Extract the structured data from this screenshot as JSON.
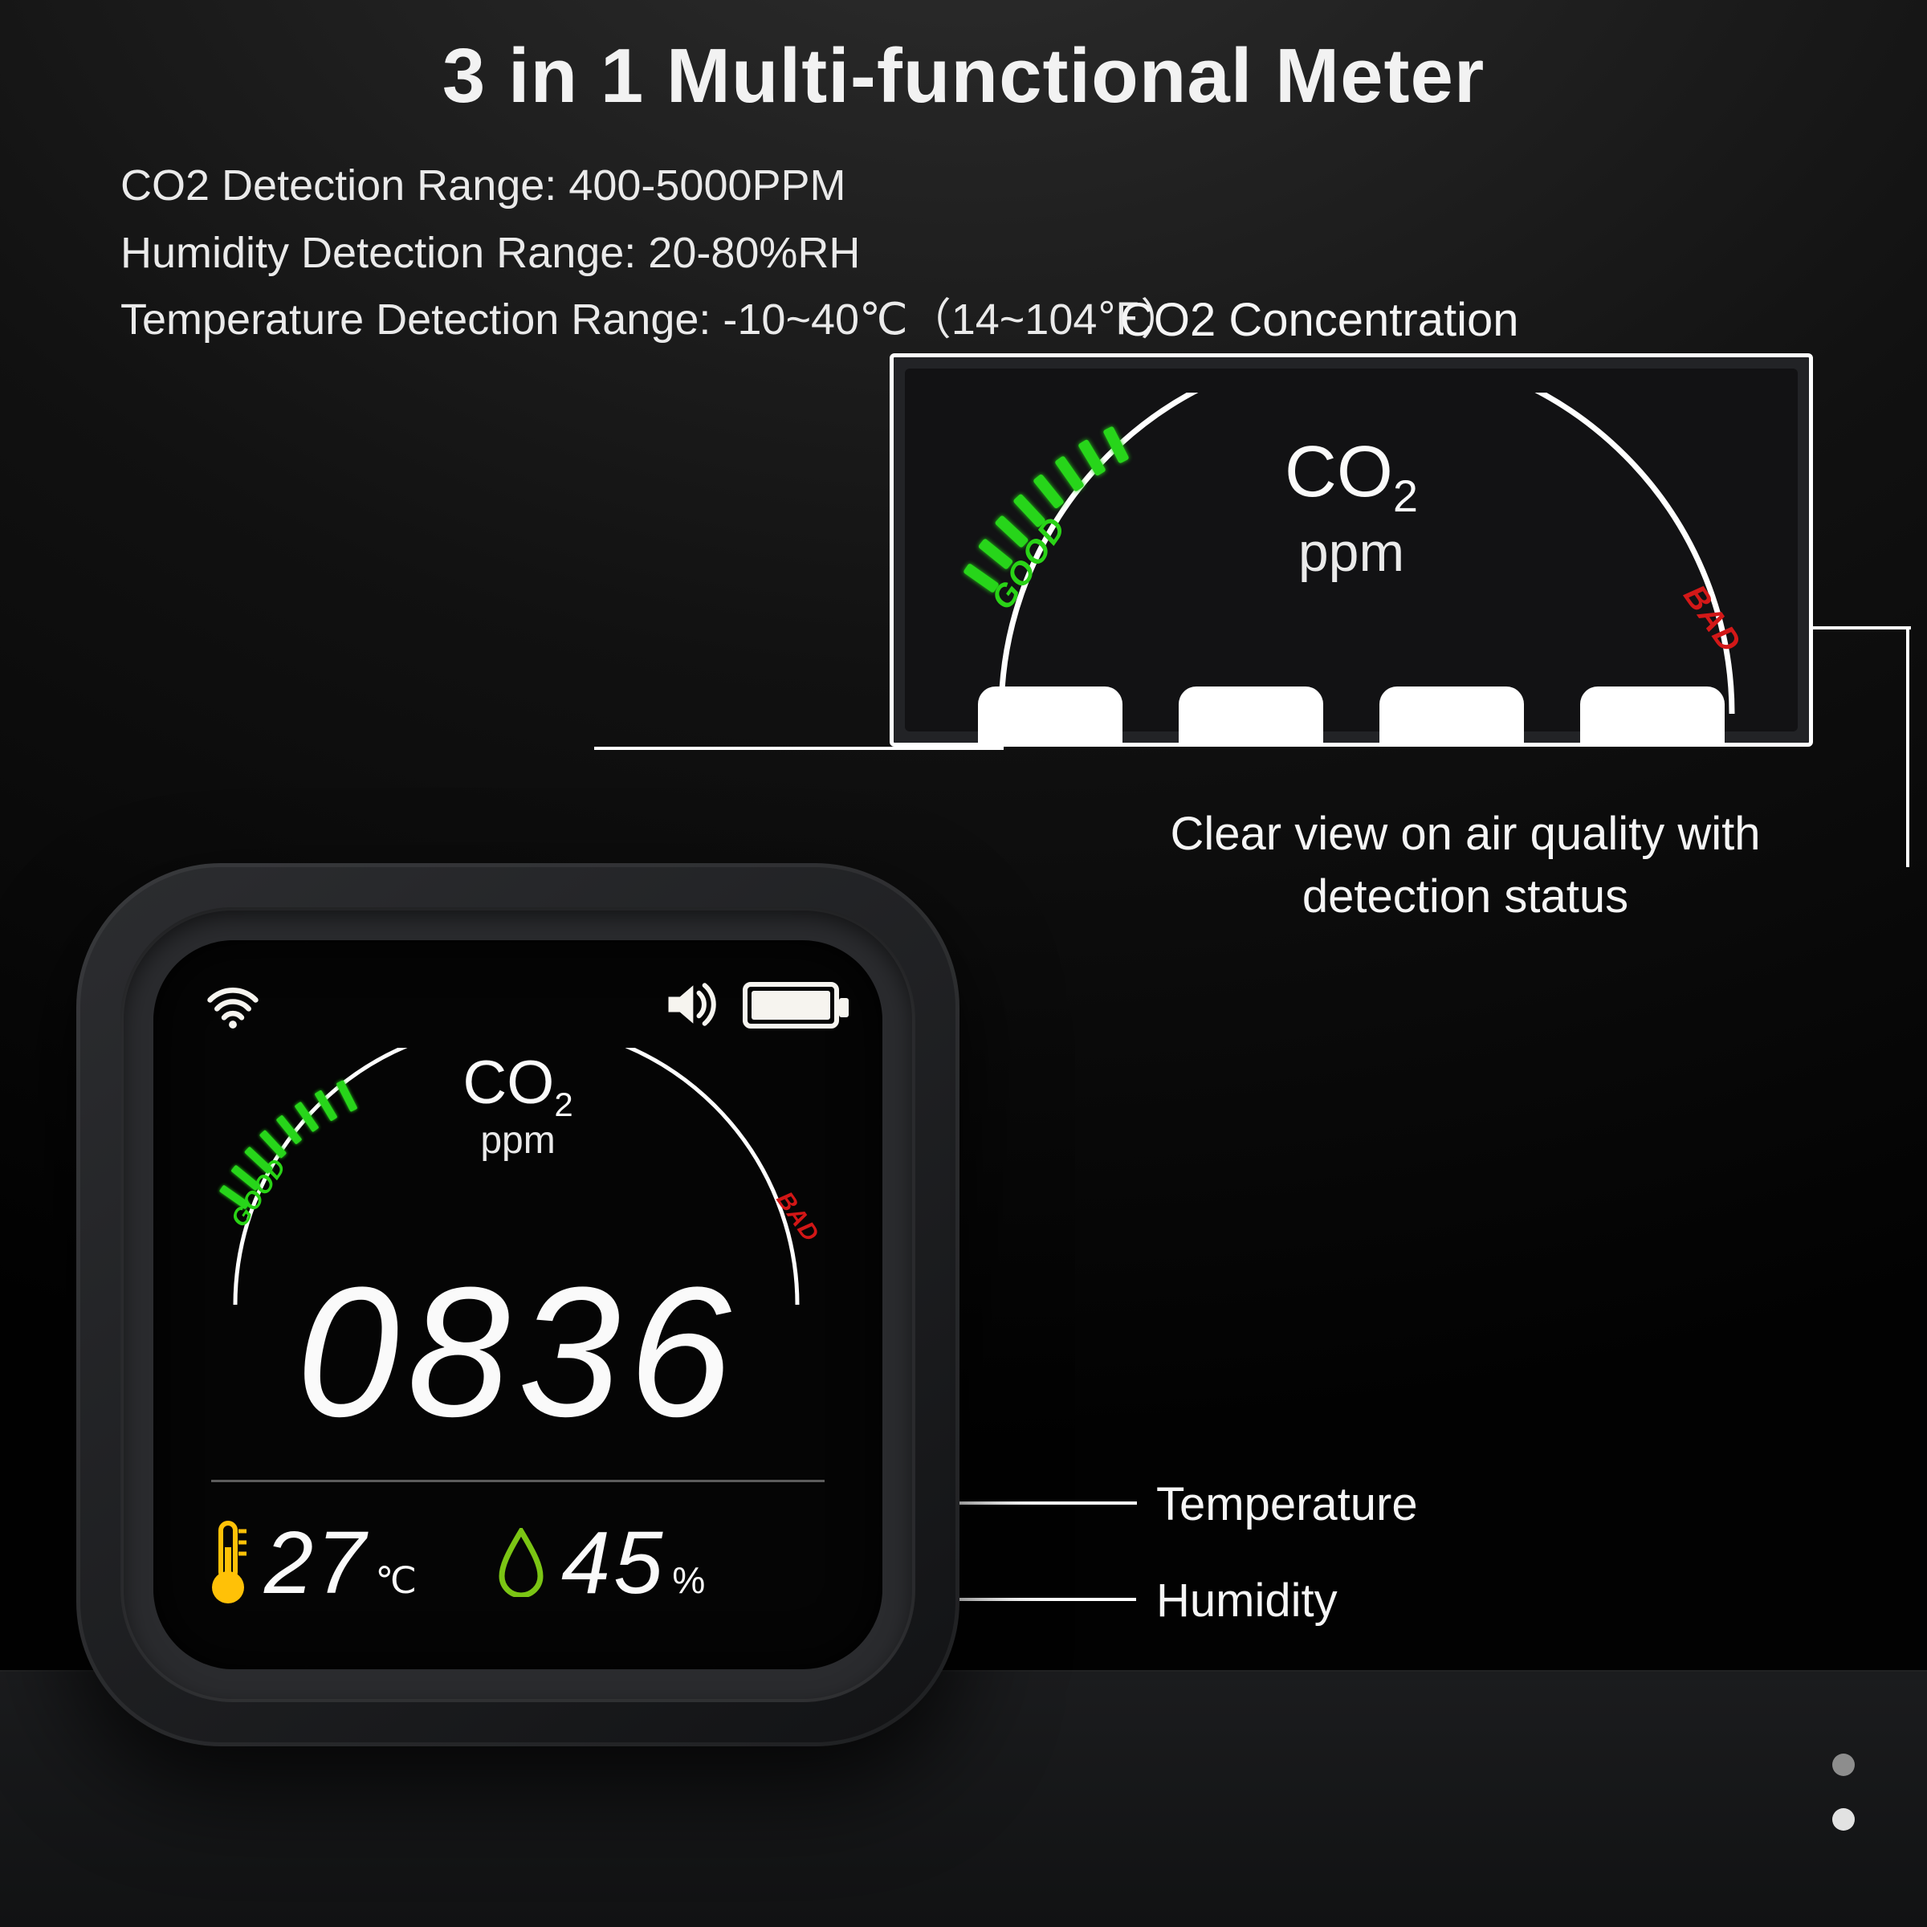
{
  "title": "3 in 1 Multi-functional Meter",
  "specs": {
    "co2": "CO2 Detection Range: 400-5000PPM",
    "hum": "Humidity Detection Range: 20-80%RH",
    "temp": "Temperature Detection Range: -10~40℃（14~104℉）"
  },
  "callouts": {
    "co2_concentration": "CO2 Concentration",
    "clear_view": "Clear view on air quality with detection status",
    "temperature": "Temperature",
    "humidity": "Humidity"
  },
  "panel": {
    "good": "GOOD",
    "bad": "BAD",
    "co2_label": "CO",
    "co2_sub": "2",
    "ppm": "ppm"
  },
  "device": {
    "icons": {
      "wifi": "wifi-icon",
      "speaker": "speaker-icon",
      "battery": "battery-icon"
    },
    "gauge": {
      "co2_label": "CO",
      "co2_sub": "2",
      "ppm": "ppm",
      "good": "GOOD",
      "bad": "BAD"
    },
    "readout": "0836",
    "temperature": {
      "value": "27",
      "unit": "℃"
    },
    "humidity": {
      "value": "45",
      "unit": "%"
    }
  },
  "colors": {
    "good": "#27d51a",
    "bad": "#d21616",
    "temp_icon": "#ffc107",
    "hum_icon": "#7bc514"
  }
}
